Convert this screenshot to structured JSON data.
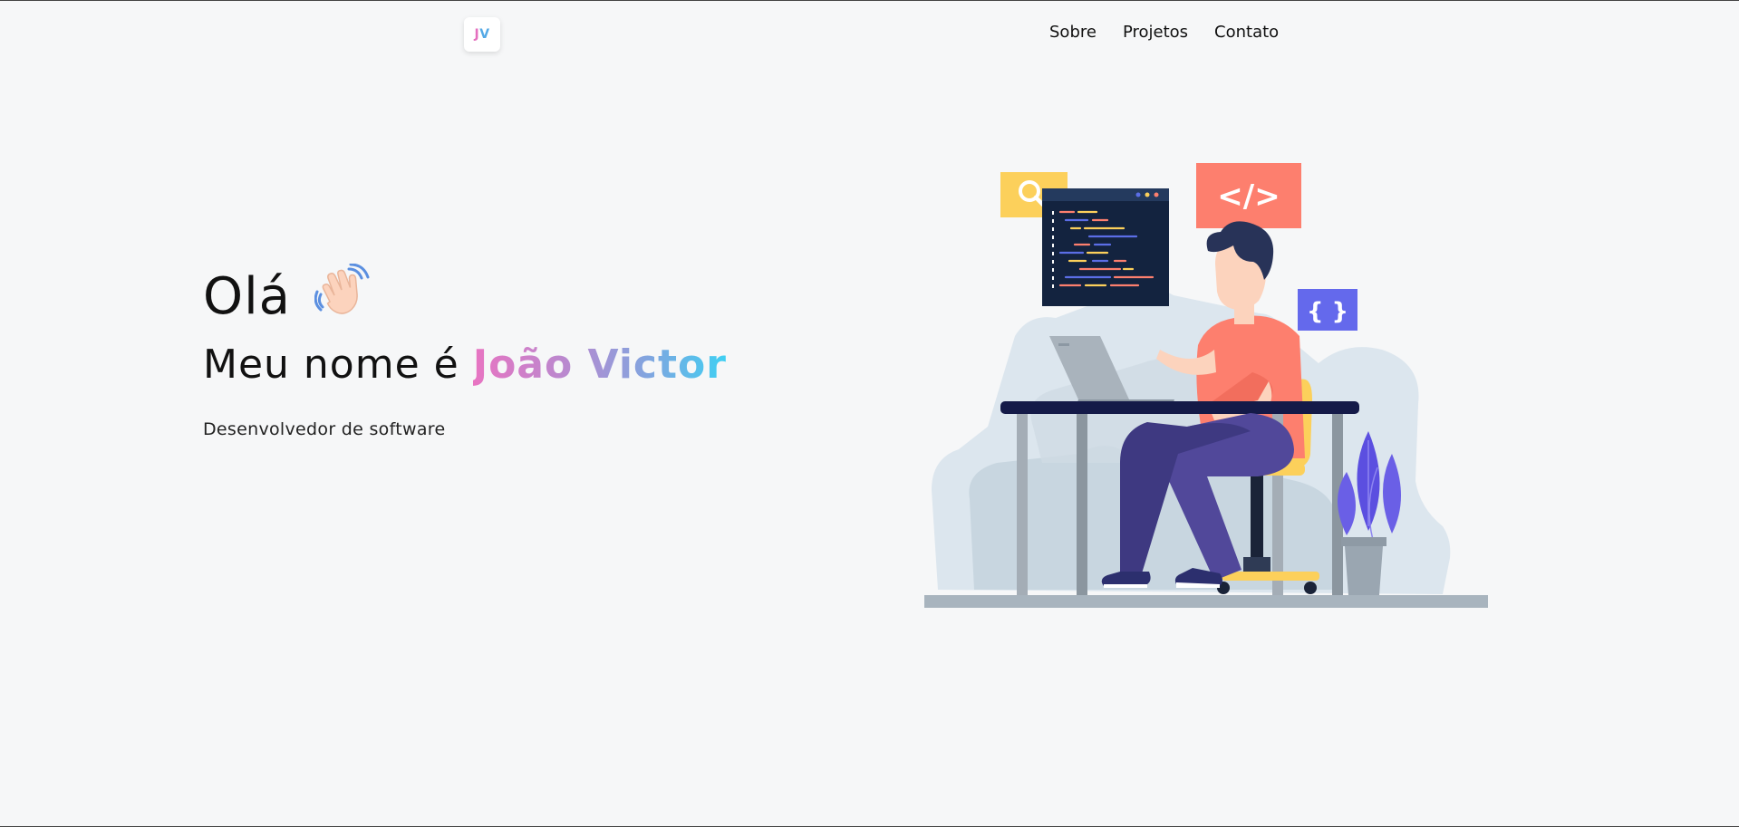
{
  "header": {
    "logo": {
      "j": "J",
      "v": "V"
    },
    "nav": [
      {
        "label": "Sobre"
      },
      {
        "label": "Projetos"
      },
      {
        "label": "Contato"
      }
    ]
  },
  "hero": {
    "greeting": "Olá",
    "greeting_icon": "waving-hand-icon",
    "name_prefix": "Meu nome é",
    "name": "João Victor",
    "role": "Desenvolvedor de software"
  },
  "illustration": {
    "code_tag": "</>",
    "braces_tag": "{ }",
    "icons": [
      "search-icon",
      "code-window",
      "laptop",
      "plant"
    ]
  },
  "colors": {
    "background": "#f6f7f8",
    "gradient_start": "#e874c2",
    "gradient_end": "#3fd0f3",
    "accent_yellow": "#fcd05b",
    "accent_coral": "#fd7f6e",
    "accent_indigo": "#6469ec"
  }
}
